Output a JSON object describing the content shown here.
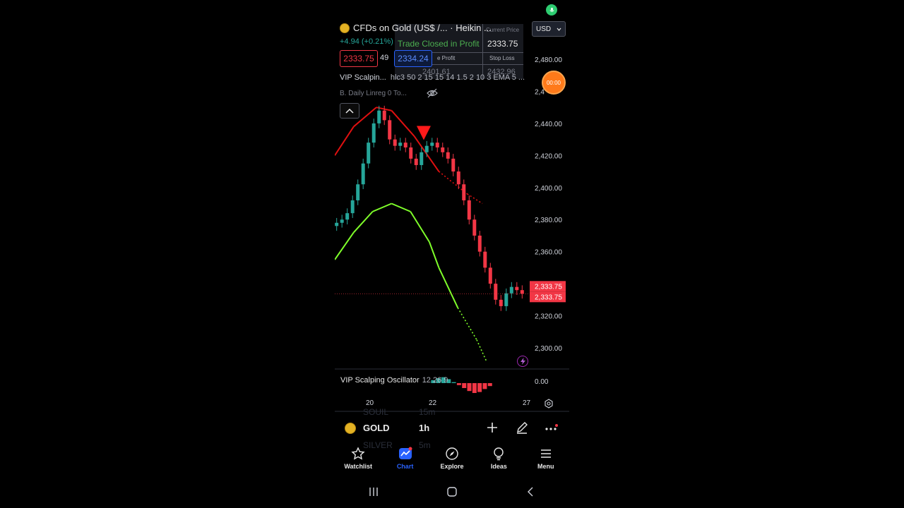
{
  "header": {
    "title": "CFDs on Gold (US$ /...  · Heikin ...",
    "change": "+4.94 (+0.21%)",
    "sell_price": "2333.75",
    "spread": "49",
    "buy_price": "2334.24",
    "currency": "USD",
    "timer": "00:00"
  },
  "trade_panel": {
    "status": "Trade Closed in Profit",
    "current_price_label": "Current Price",
    "current_price": "2333.75",
    "take_profit_label": "e Profit",
    "take_profit": "2401.61",
    "stop_loss_label": "Stop Loss",
    "stop_loss": "2432.96"
  },
  "indicators": {
    "main_name": "VIP Scalpin...",
    "main_args": "hlc3 50 2 15 15 14 1.5 2 10 3 EMA 5 ...",
    "linreg": "B.  Daily Linreg 0 To..."
  },
  "oscillator": {
    "name": "VIP Scalping Oscillator",
    "args": "12 26 9",
    "zero_label": "0.00"
  },
  "symbol_bar": {
    "symbol": "GOLD",
    "timeframe": "1h",
    "ghost_above_symbol": "SOUIL",
    "ghost_above_tf": "15m",
    "ghost_below_symbol": "SILVER",
    "ghost_below_tf": "5m"
  },
  "nav": {
    "items": [
      {
        "label": "Watchlist"
      },
      {
        "label": "Chart"
      },
      {
        "label": "Explore"
      },
      {
        "label": "Ideas"
      },
      {
        "label": "Menu"
      }
    ]
  },
  "colors": {
    "bull": "#26a69a",
    "bear": "#f23645",
    "upper_band": "#e01010",
    "lower_band": "#7fff2a",
    "price_tag": "#f23645"
  },
  "chart_data": {
    "type": "candlestick",
    "style": "Heikin Ashi",
    "y_axis": {
      "range": [
        2285,
        2490
      ],
      "ticks": [
        2480.0,
        2460.0,
        2440.0,
        2420.0,
        2400.0,
        2380.0,
        2360.0,
        2340.0,
        2320.0,
        2300.0
      ],
      "tick_labels": [
        "2,480.00",
        "2,4",
        "2,440.00",
        "2,420.00",
        "2,400.00",
        "2,380.00",
        "2,360.00",
        "",
        "2,320.00",
        "2,300.00"
      ]
    },
    "x_axis": {
      "tick_labels": [
        "20",
        "22",
        "27"
      ],
      "tick_positions": [
        0.15,
        0.42,
        0.96
      ]
    },
    "last_price_labels": [
      "2,333.75",
      "2,333.75"
    ],
    "last_price": 2333.75,
    "close_series": [
      2378,
      2380,
      2384,
      2392,
      2402,
      2415,
      2428,
      2440,
      2448,
      2442,
      2430,
      2426,
      2428,
      2425,
      2418,
      2414,
      2422,
      2426,
      2428,
      2425,
      2422,
      2418,
      2410,
      2402,
      2392,
      2380,
      2370,
      2360,
      2350,
      2340,
      2330,
      2326,
      2334,
      2338,
      2336,
      2333.75
    ],
    "upper_band": [
      [
        0.0,
        2420
      ],
      [
        0.1,
        2438
      ],
      [
        0.22,
        2450
      ],
      [
        0.3,
        2448
      ],
      [
        0.42,
        2432
      ],
      [
        0.55,
        2410
      ],
      [
        0.7,
        2396
      ],
      [
        0.78,
        2390
      ]
    ],
    "lower_band": [
      [
        0.0,
        2355
      ],
      [
        0.1,
        2372
      ],
      [
        0.2,
        2385
      ],
      [
        0.3,
        2390
      ],
      [
        0.4,
        2385
      ],
      [
        0.5,
        2366
      ],
      [
        0.55,
        2350
      ],
      [
        0.65,
        2325
      ],
      [
        0.75,
        2305
      ],
      [
        0.8,
        2292
      ]
    ],
    "sell_signal": {
      "x": 0.47,
      "price": 2434
    },
    "oscillator": {
      "zero": 0.0,
      "hist_start": 0.52,
      "hist_end": 0.82,
      "series": [
        0.3,
        0.5,
        0.6,
        0.4,
        0.1,
        -0.2,
        -0.5,
        -0.8,
        -1.0,
        -0.9,
        -0.6,
        -0.3
      ]
    }
  }
}
